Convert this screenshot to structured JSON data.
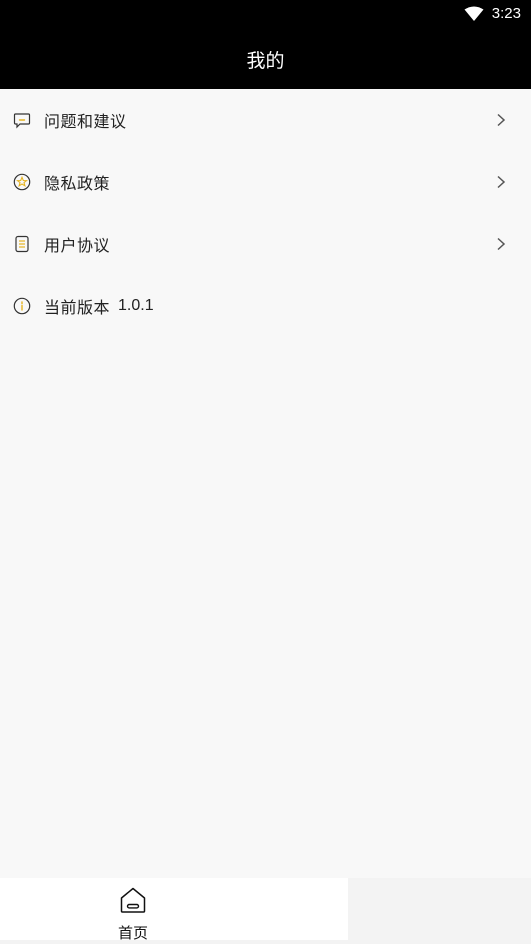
{
  "status_bar": {
    "time": "3:23",
    "wifi_icon": "wifi-icon",
    "background": "#000000"
  },
  "header": {
    "title": "我的"
  },
  "menu": {
    "items": [
      {
        "label": "问题和建议",
        "icon": "feedback-icon",
        "has_arrow": true
      },
      {
        "label": "隐私政策",
        "icon": "privacy-star-icon",
        "has_arrow": true
      },
      {
        "label": "用户协议",
        "icon": "document-icon",
        "has_arrow": true
      },
      {
        "label": "当前版本",
        "icon": "info-icon",
        "value": "1.0.1",
        "has_arrow": false
      }
    ]
  },
  "tab_bar": {
    "tabs": [
      {
        "label": "首页",
        "icon": "home-icon",
        "active": true
      }
    ]
  },
  "colors": {
    "header_bg": "#000000",
    "header_text": "#ffffff",
    "page_bg": "#f8f8f8",
    "icon_accent": "#e6b422"
  }
}
